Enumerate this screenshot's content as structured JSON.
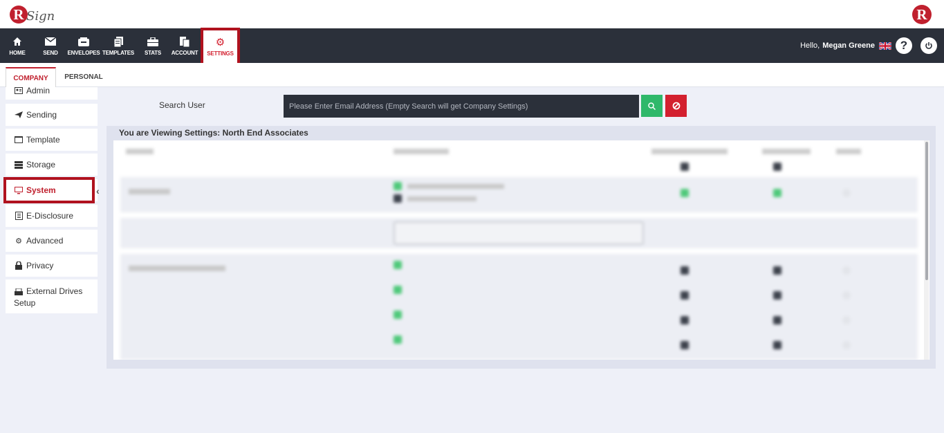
{
  "brand": {
    "logo_letter": "R",
    "logo_word": "Sign"
  },
  "nav": {
    "items": [
      {
        "label": "HOME",
        "icon": "home-icon"
      },
      {
        "label": "SEND",
        "icon": "envelope-icon"
      },
      {
        "label": "ENVELOPES",
        "icon": "inbox-icon"
      },
      {
        "label": "TEMPLATES",
        "icon": "template-icon"
      },
      {
        "label": "STATS",
        "icon": "briefcase-icon"
      },
      {
        "label": "ACCOUNT",
        "icon": "account-icon"
      },
      {
        "label": "SETTINGS",
        "icon": "gear-icon"
      }
    ],
    "active": "SETTINGS"
  },
  "user": {
    "greeting": "Hello,",
    "name": "Megan Greene"
  },
  "subtabs": {
    "company": "COMPANY",
    "personal": "PERSONAL"
  },
  "sidebar": {
    "items": [
      {
        "label": "Admin",
        "icon": "admin-card-icon"
      },
      {
        "label": "Sending",
        "icon": "paper-plane-icon"
      },
      {
        "label": "Template",
        "icon": "window-icon"
      },
      {
        "label": "Storage",
        "icon": "database-icon"
      },
      {
        "label": "System",
        "icon": "monitor-icon"
      },
      {
        "label": "E-Disclosure",
        "icon": "document-icon"
      },
      {
        "label": "Advanced",
        "icon": "gears-icon"
      },
      {
        "label": "Privacy",
        "icon": "lock-icon"
      },
      {
        "label": "External Drives Setup",
        "icon": "drive-icon"
      }
    ],
    "active": "System"
  },
  "search": {
    "label": "Search User",
    "placeholder": "Please Enter Email Address (Empty Search will get Company Settings)"
  },
  "panel": {
    "title": "You are Viewing Settings: North End Associates"
  },
  "colors": {
    "accent": "#c0202e",
    "nav_bg": "#2b303a",
    "search_green": "#2fb86a",
    "clear_red": "#d3202f"
  }
}
